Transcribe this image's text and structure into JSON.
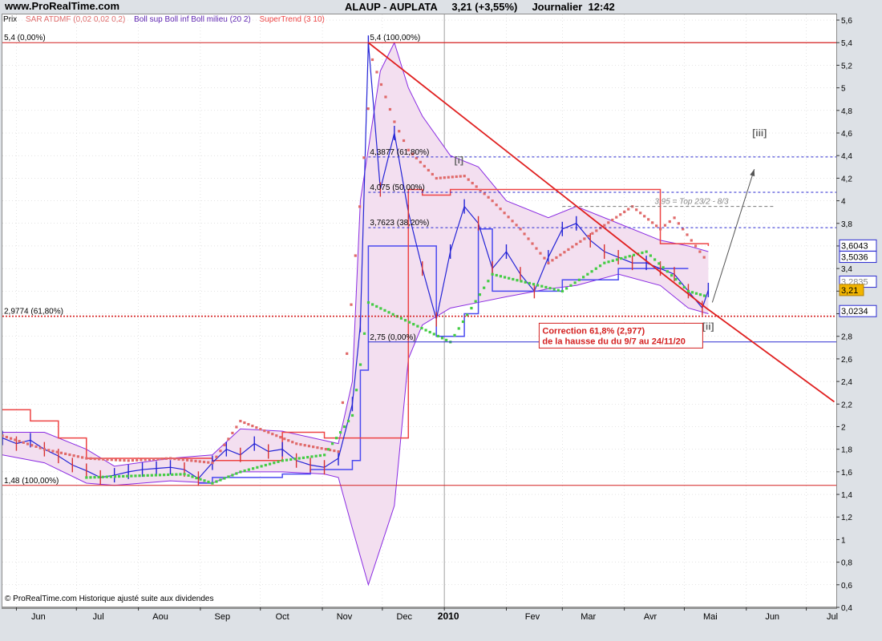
{
  "header": {
    "site": "www.ProRealTime.com",
    "title": "ALAUP - AUPLATA     3,21 (+3,55%)     Journalier  12:42"
  },
  "legend": {
    "prix": "Prix",
    "sar": "SAR ATDMF (0,02 0,02 0,2)",
    "boll": "Boll sup Boll inf Boll milieu (20 2)",
    "supertrend": "SuperTrend (3 10)"
  },
  "credit": "© ProRealTime.com Historique ajusté suite aux dividendes",
  "colors": {
    "price": "#2424d6",
    "price_down": "#d83030",
    "boll": "#8a2be2",
    "boll_fill": "#f3dff0",
    "sar_bear": "#e06a6a",
    "sar_bull": "#44cc44",
    "supertrend": "#ee4444",
    "trendline": "#e02020",
    "level_red": "#d42020",
    "level_blue": "#2a2ad0",
    "grid": "#c8c8c8"
  },
  "chart_data": {
    "type": "line",
    "x_labels": [
      "Jun",
      "Jul",
      "Aou",
      "Sep",
      "Oct",
      "Nov",
      "Dec",
      "2010",
      "Fev",
      "Mar",
      "Avr",
      "Mai",
      "Jun",
      "Jul"
    ],
    "y_ticks": [
      "0,4",
      "0,6",
      "0,8",
      "1",
      "1,2",
      "1,4",
      "1,6",
      "1,8",
      "2",
      "2,2",
      "2,4",
      "2,6",
      "2,8",
      "3",
      "3,2",
      "3,4",
      "3,6",
      "3,8",
      "4",
      "4,2",
      "4,4",
      "4,6",
      "4,8",
      "5",
      "5,2",
      "5,4",
      "5,6"
    ],
    "ylim": [
      0.4,
      5.65
    ],
    "price_close": [
      [
        "2009-05-25",
        1.9
      ],
      [
        "2009-06-01",
        1.85
      ],
      [
        "2009-06-08",
        1.88
      ],
      [
        "2009-06-15",
        1.8
      ],
      [
        "2009-06-22",
        1.74
      ],
      [
        "2009-06-29",
        1.66
      ],
      [
        "2009-07-06",
        1.61
      ],
      [
        "2009-07-13",
        1.55
      ],
      [
        "2009-07-20",
        1.57
      ],
      [
        "2009-07-27",
        1.6
      ],
      [
        "2009-08-03",
        1.62
      ],
      [
        "2009-08-10",
        1.63
      ],
      [
        "2009-08-17",
        1.64
      ],
      [
        "2009-08-24",
        1.62
      ],
      [
        "2009-08-31",
        1.54
      ],
      [
        "2009-09-07",
        1.68
      ],
      [
        "2009-09-14",
        1.8
      ],
      [
        "2009-09-21",
        1.75
      ],
      [
        "2009-09-28",
        1.85
      ],
      [
        "2009-10-05",
        1.78
      ],
      [
        "2009-10-12",
        1.8
      ],
      [
        "2009-10-19",
        1.7
      ],
      [
        "2009-10-26",
        1.66
      ],
      [
        "2009-11-02",
        1.64
      ],
      [
        "2009-11-09",
        1.72
      ],
      [
        "2009-11-16",
        2.2
      ],
      [
        "2009-11-20",
        2.9
      ],
      [
        "2009-11-24",
        5.4
      ],
      [
        "2009-11-30",
        4.1
      ],
      [
        "2009-12-07",
        4.6
      ],
      [
        "2009-12-14",
        3.9
      ],
      [
        "2009-12-21",
        3.4
      ],
      [
        "2009-12-28",
        2.95
      ],
      [
        "2010-01-04",
        3.55
      ],
      [
        "2010-01-11",
        3.95
      ],
      [
        "2010-01-18",
        3.8
      ],
      [
        "2010-01-25",
        3.4
      ],
      [
        "2010-02-01",
        3.55
      ],
      [
        "2010-02-08",
        3.35
      ],
      [
        "2010-02-15",
        3.2
      ],
      [
        "2010-02-22",
        3.5
      ],
      [
        "2010-03-01",
        3.75
      ],
      [
        "2010-03-08",
        3.8
      ],
      [
        "2010-03-15",
        3.65
      ],
      [
        "2010-03-22",
        3.55
      ],
      [
        "2010-03-29",
        3.5
      ],
      [
        "2010-04-05",
        3.45
      ],
      [
        "2010-04-12",
        3.45
      ],
      [
        "2010-04-19",
        3.4
      ],
      [
        "2010-04-26",
        3.35
      ],
      [
        "2010-05-03",
        3.2
      ],
      [
        "2010-05-10",
        3.05
      ],
      [
        "2010-05-13",
        3.21
      ]
    ],
    "boll_upper": [
      [
        "2009-05-25",
        1.95
      ],
      [
        "2009-06-15",
        1.95
      ],
      [
        "2009-07-06",
        1.8
      ],
      [
        "2009-07-20",
        1.65
      ],
      [
        "2009-08-17",
        1.72
      ],
      [
        "2009-09-07",
        1.75
      ],
      [
        "2009-09-21",
        1.98
      ],
      [
        "2009-10-12",
        1.96
      ],
      [
        "2009-11-09",
        1.85
      ],
      [
        "2009-11-16",
        2.4
      ],
      [
        "2009-11-20",
        4.0
      ],
      [
        "2009-11-30",
        5.15
      ],
      [
        "2009-12-07",
        5.4
      ],
      [
        "2009-12-14",
        5.0
      ],
      [
        "2009-12-21",
        4.75
      ],
      [
        "2010-01-04",
        4.4
      ],
      [
        "2010-01-18",
        4.3
      ],
      [
        "2010-02-01",
        4.0
      ],
      [
        "2010-02-22",
        3.85
      ],
      [
        "2010-03-08",
        3.95
      ],
      [
        "2010-03-29",
        3.8
      ],
      [
        "2010-04-19",
        3.65
      ],
      [
        "2010-05-03",
        3.6
      ],
      [
        "2010-05-13",
        3.55
      ]
    ],
    "boll_lower": [
      [
        "2009-05-25",
        1.75
      ],
      [
        "2009-06-15",
        1.68
      ],
      [
        "2009-07-06",
        1.5
      ],
      [
        "2009-07-20",
        1.48
      ],
      [
        "2009-08-17",
        1.52
      ],
      [
        "2009-09-07",
        1.5
      ],
      [
        "2009-09-21",
        1.6
      ],
      [
        "2009-10-12",
        1.6
      ],
      [
        "2009-11-02",
        1.58
      ],
      [
        "2009-11-09",
        1.55
      ],
      [
        "2009-11-16",
        1.1
      ],
      [
        "2009-11-24",
        0.6
      ],
      [
        "2009-12-07",
        1.3
      ],
      [
        "2009-12-14",
        2.6
      ],
      [
        "2009-12-21",
        2.9
      ],
      [
        "2010-01-04",
        3.05
      ],
      [
        "2010-01-18",
        3.1
      ],
      [
        "2010-02-01",
        3.15
      ],
      [
        "2010-02-22",
        3.22
      ],
      [
        "2010-03-08",
        3.25
      ],
      [
        "2010-03-29",
        3.35
      ],
      [
        "2010-04-19",
        3.25
      ],
      [
        "2010-05-03",
        3.05
      ],
      [
        "2010-05-13",
        3.0
      ]
    ],
    "supertrend_bull": [
      [
        "2009-08-31",
        1.5
      ],
      [
        "2009-09-07",
        1.55
      ],
      [
        "2009-10-12",
        1.58
      ],
      [
        "2009-10-26",
        1.62
      ],
      [
        "2009-11-09",
        1.62
      ],
      [
        "2009-11-16",
        1.7
      ],
      [
        "2009-11-20",
        2.5
      ],
      [
        "2009-11-24",
        3.6
      ],
      [
        "2009-12-21",
        3.6
      ],
      [
        "2009-12-28",
        2.8
      ],
      [
        "2010-01-11",
        3.0
      ],
      [
        "2010-01-18",
        3.75
      ],
      [
        "2010-01-25",
        3.2
      ],
      [
        "2010-02-22",
        3.2
      ],
      [
        "2010-03-01",
        3.3
      ],
      [
        "2010-03-29",
        3.4
      ],
      [
        "2010-05-03",
        3.4
      ]
    ],
    "supertrend_bear": [
      [
        "2009-05-25",
        2.15
      ],
      [
        "2009-06-08",
        2.05
      ],
      [
        "2009-06-22",
        1.9
      ],
      [
        "2009-07-06",
        1.72
      ],
      [
        "2009-08-10",
        1.72
      ],
      [
        "2009-09-07",
        1.7
      ],
      [
        "2009-10-12",
        1.95
      ],
      [
        "2009-11-02",
        1.9
      ],
      [
        "2009-12-14",
        4.1
      ],
      [
        "2009-12-21",
        4.05
      ],
      [
        "2010-01-04",
        4.1
      ],
      [
        "2010-04-19",
        3.62
      ],
      [
        "2010-05-13",
        3.6
      ]
    ],
    "sar_bear": [
      [
        "2009-05-25",
        1.92
      ],
      [
        "2009-06-15",
        1.8
      ],
      [
        "2009-07-06",
        1.72
      ],
      [
        "2009-07-27",
        1.7
      ],
      [
        "2009-08-17",
        1.72
      ],
      [
        "2009-09-07",
        1.68
      ],
      [
        "2009-09-21",
        2.05
      ],
      [
        "2009-10-05",
        1.95
      ],
      [
        "2009-10-19",
        1.85
      ],
      [
        "2009-11-09",
        1.78
      ],
      [
        "2009-11-26",
        5.25
      ],
      [
        "2009-12-07",
        4.7
      ],
      [
        "2009-12-14",
        4.45
      ],
      [
        "2009-12-28",
        4.2
      ],
      [
        "2010-01-11",
        4.22
      ],
      [
        "2010-01-25",
        4.0
      ],
      [
        "2010-02-08",
        3.75
      ],
      [
        "2010-02-22",
        3.45
      ],
      [
        "2010-04-05",
        3.95
      ],
      [
        "2010-04-19",
        3.75
      ],
      [
        "2010-04-26",
        3.85
      ],
      [
        "2010-05-13",
        3.45
      ]
    ],
    "sar_bull": [
      [
        "2009-07-06",
        1.55
      ],
      [
        "2009-08-24",
        1.58
      ],
      [
        "2009-09-07",
        1.5
      ],
      [
        "2009-09-21",
        1.6
      ],
      [
        "2009-10-12",
        1.7
      ],
      [
        "2009-11-02",
        1.75
      ],
      [
        "2009-11-16",
        2.1
      ],
      [
        "2009-11-20",
        2.55
      ],
      [
        "2009-11-24",
        3.1
      ],
      [
        "2010-01-04",
        2.75
      ],
      [
        "2010-01-25",
        3.35
      ],
      [
        "2010-03-01",
        3.2
      ],
      [
        "2010-03-22",
        3.45
      ],
      [
        "2010-04-12",
        3.55
      ],
      [
        "2010-05-03",
        3.2
      ],
      [
        "2010-05-13",
        3.15
      ]
    ],
    "trendline": [
      [
        "2009-11-24",
        5.4
      ],
      [
        "2010-05-12",
        3.05
      ],
      [
        "2010-07-15",
        2.22
      ]
    ],
    "arrow": [
      [
        "2010-05-15",
        3.1
      ],
      [
        "2010-06-05",
        4.28
      ]
    ],
    "levels": [
      {
        "y": 5.4,
        "label": "5,4 (0,00%)",
        "style": "red-solid",
        "x_from": "2009-05-25"
      },
      {
        "y": 5.4,
        "label": "5,4 (100,00%)",
        "style": "red-solid",
        "x_from": "2009-11-24"
      },
      {
        "y": 4.3877,
        "label": "4,3877 (61,80%)",
        "style": "blue-dash",
        "x_from": "2009-11-24"
      },
      {
        "y": 4.075,
        "label": "4,075 (50,00%)",
        "style": "blue-dash",
        "x_from": "2009-11-24"
      },
      {
        "y": 3.7623,
        "label": "3,7623 (38,20%)",
        "style": "blue-dash",
        "x_from": "2009-11-24"
      },
      {
        "y": 2.9774,
        "label": "2,9774 (61,80%)",
        "style": "red-dot",
        "x_from": "2009-05-25"
      },
      {
        "y": 2.75,
        "label": "2,75 (0,00%)",
        "style": "blue-solid",
        "x_from": "2009-11-24"
      },
      {
        "y": 1.48,
        "label": "1,48 (100,00%)",
        "style": "red-solid",
        "x_from": "2009-05-25"
      }
    ],
    "top_line": {
      "y": 3.95,
      "label": "3,95 = Top 23/2 - 8/3",
      "x_from": "2010-03-01",
      "x_to": "2010-06-15"
    },
    "annotations": [
      {
        "text": "[i]",
        "x": "2010-01-06",
        "y": 4.33
      },
      {
        "text": "[ii]",
        "x": "2010-05-10",
        "y": 2.86
      },
      {
        "text": "[iii]",
        "x": "2010-06-04",
        "y": 4.57
      }
    ],
    "callout": {
      "line1": "Correction 61,8% (2,977)",
      "line2": "de la hausse du du 9/7 au 24/11/20",
      "x": "2010-02-15",
      "y": 2.93
    },
    "price_boxes": [
      {
        "text": "3,6043",
        "y": 3.6043,
        "kind": "normal"
      },
      {
        "text": "3,5036",
        "y": 3.5036,
        "kind": "normal"
      },
      {
        "text": "3,2835",
        "y": 3.2835,
        "kind": "faded"
      },
      {
        "text": "3,21",
        "y": 3.21,
        "kind": "current"
      },
      {
        "text": "3,0234",
        "y": 3.0234,
        "kind": "normal"
      }
    ],
    "grid": true
  }
}
